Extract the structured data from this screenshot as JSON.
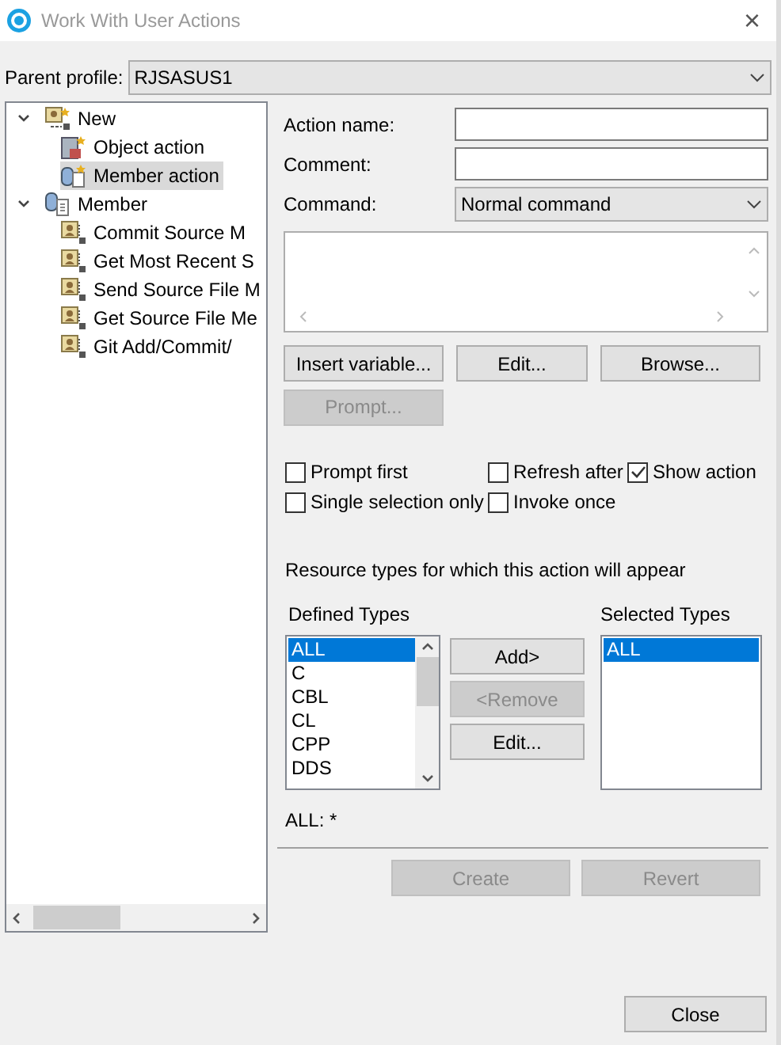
{
  "window": {
    "title": "Work With User Actions",
    "close_label": "×"
  },
  "parent_profile": {
    "label": "Parent profile:",
    "value": "RJSASUS1"
  },
  "tree": [
    {
      "label": "New",
      "expanded": true,
      "selected": false,
      "kind": "new",
      "children": [
        {
          "label": "Object action",
          "selected": false,
          "kind": "object"
        },
        {
          "label": "Member action",
          "selected": true,
          "kind": "membernew"
        }
      ]
    },
    {
      "label": "Member",
      "expanded": true,
      "selected": false,
      "kind": "member",
      "children": [
        {
          "label": "Commit Source M",
          "selected": false,
          "kind": "action"
        },
        {
          "label": "Get Most Recent S",
          "selected": false,
          "kind": "action"
        },
        {
          "label": "Send Source File M",
          "selected": false,
          "kind": "action"
        },
        {
          "label": "Get Source File Me",
          "selected": false,
          "kind": "action"
        },
        {
          "label": "Git Add/Commit/",
          "selected": false,
          "kind": "action"
        }
      ]
    }
  ],
  "form": {
    "action_name": {
      "label": "Action name:"
    },
    "comment": {
      "label": "Comment:"
    },
    "command": {
      "label": "Command:",
      "value": "Normal command"
    }
  },
  "command_buttons": [
    {
      "label": "Insert variable...",
      "disabled": false
    },
    {
      "label": "Edit...",
      "disabled": false
    },
    {
      "label": "Browse...",
      "disabled": false
    }
  ],
  "prompt_button": {
    "label": "Prompt...",
    "disabled": true
  },
  "options": [
    {
      "label": "Prompt first",
      "checked": false
    },
    {
      "label": "Refresh after",
      "checked": false
    },
    {
      "label": "Show action",
      "checked": true
    },
    {
      "label": "Single selection only",
      "checked": false
    },
    {
      "label": "Invoke once",
      "checked": false
    }
  ],
  "resource_types": {
    "heading": "Resource types for which this action will appear",
    "defined": {
      "label": "Defined Types",
      "items": [
        {
          "label": "ALL",
          "selected": true
        },
        {
          "label": "C",
          "selected": false
        },
        {
          "label": "CBL",
          "selected": false
        },
        {
          "label": "CL",
          "selected": false
        },
        {
          "label": "CPP",
          "selected": false
        },
        {
          "label": "DDS",
          "selected": false
        }
      ]
    },
    "buttons": [
      {
        "label": "Add>",
        "disabled": false
      },
      {
        "label": "<Remove",
        "disabled": true
      },
      {
        "label": "Edit...",
        "disabled": false
      }
    ],
    "selected": {
      "label": "Selected Types",
      "items": [
        {
          "label": "ALL",
          "selected": true
        }
      ]
    },
    "summary": "ALL: *"
  },
  "action_buttons": [
    {
      "label": "Create",
      "disabled": true
    },
    {
      "label": "Revert",
      "disabled": true
    }
  ],
  "close_button": {
    "label": "Close",
    "disabled": false
  }
}
